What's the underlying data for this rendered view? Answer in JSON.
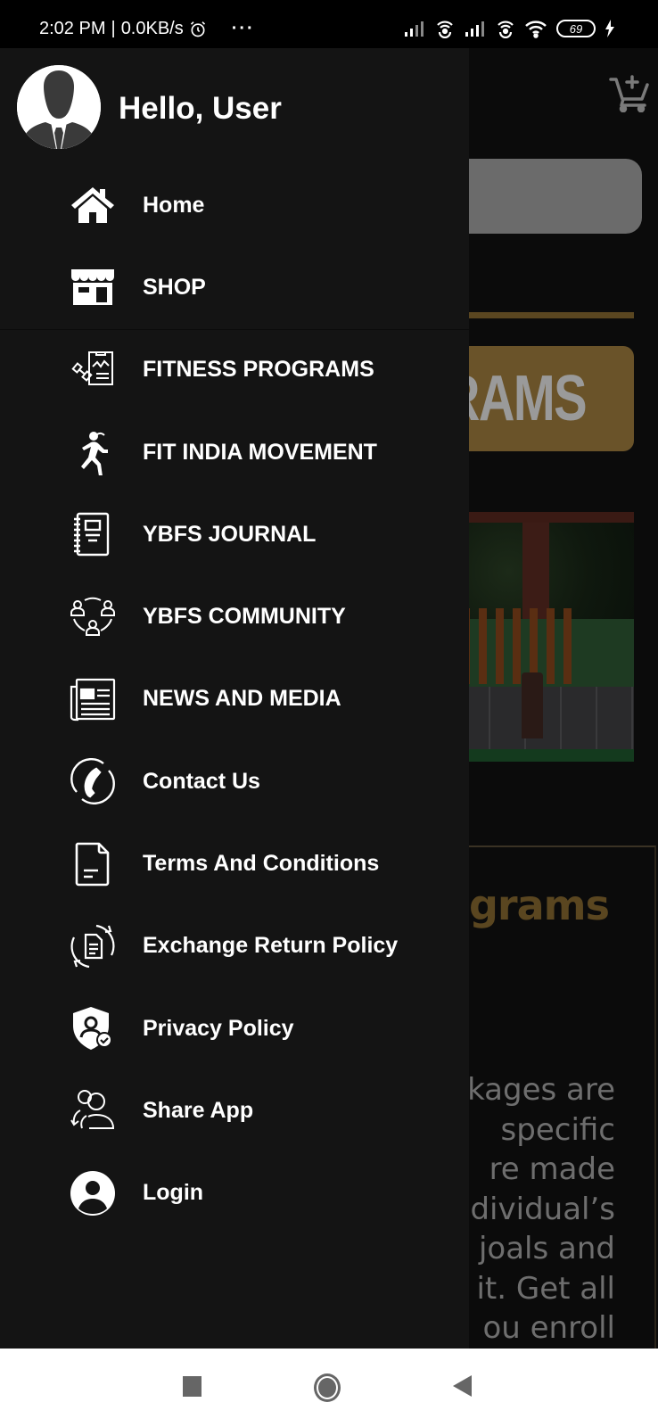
{
  "status_bar": {
    "time": "2:02 PM",
    "network_speed": "0.0KB/s",
    "separator": "|",
    "more_dots": "···",
    "battery_level": "69",
    "icons": [
      "alarm-icon",
      "signal-icon",
      "hotspot-icon",
      "signal-icon",
      "hotspot-icon",
      "wifi-icon",
      "battery-icon",
      "charging-icon"
    ]
  },
  "drawer": {
    "greeting": "Hello, User",
    "avatar_icon": "user-silhouette-icon",
    "items": [
      {
        "label": "Home",
        "icon": "home-icon"
      },
      {
        "label": "SHOP",
        "icon": "shop-icon"
      },
      {
        "label": "FITNESS PROGRAMS",
        "icon": "fitness-program-icon"
      },
      {
        "label": "FIT INDIA MOVEMENT",
        "icon": "running-person-icon"
      },
      {
        "label": "YBFS JOURNAL",
        "icon": "journal-icon"
      },
      {
        "label": "YBFS COMMUNITY",
        "icon": "community-icon"
      },
      {
        "label": "NEWS AND MEDIA",
        "icon": "newspaper-icon"
      },
      {
        "label": "Contact Us",
        "icon": "phone-icon"
      },
      {
        "label": "Terms And Conditions",
        "icon": "document-icon"
      },
      {
        "label": "Exchange Return Policy",
        "icon": "exchange-document-icon"
      },
      {
        "label": "Privacy Policy",
        "icon": "privacy-shield-icon"
      },
      {
        "label": "Share App",
        "icon": "share-users-icon"
      },
      {
        "label": "Login",
        "icon": "account-circle-icon"
      }
    ]
  },
  "background_screen": {
    "cart_icon": "add-to-cart-icon",
    "programs_button_text": "RAMS",
    "section_title": "grams",
    "body_lines": [
      "kages are",
      "specific",
      "re   made",
      "dividual’s",
      "joals  and",
      "it. Get all",
      "ou  enroll"
    ],
    "colors": {
      "gold": "#6a5329",
      "gold_text": "#5a4620"
    }
  },
  "nav_bar": {
    "recent_label": "Recent apps",
    "home_label": "Home",
    "back_label": "Back"
  }
}
